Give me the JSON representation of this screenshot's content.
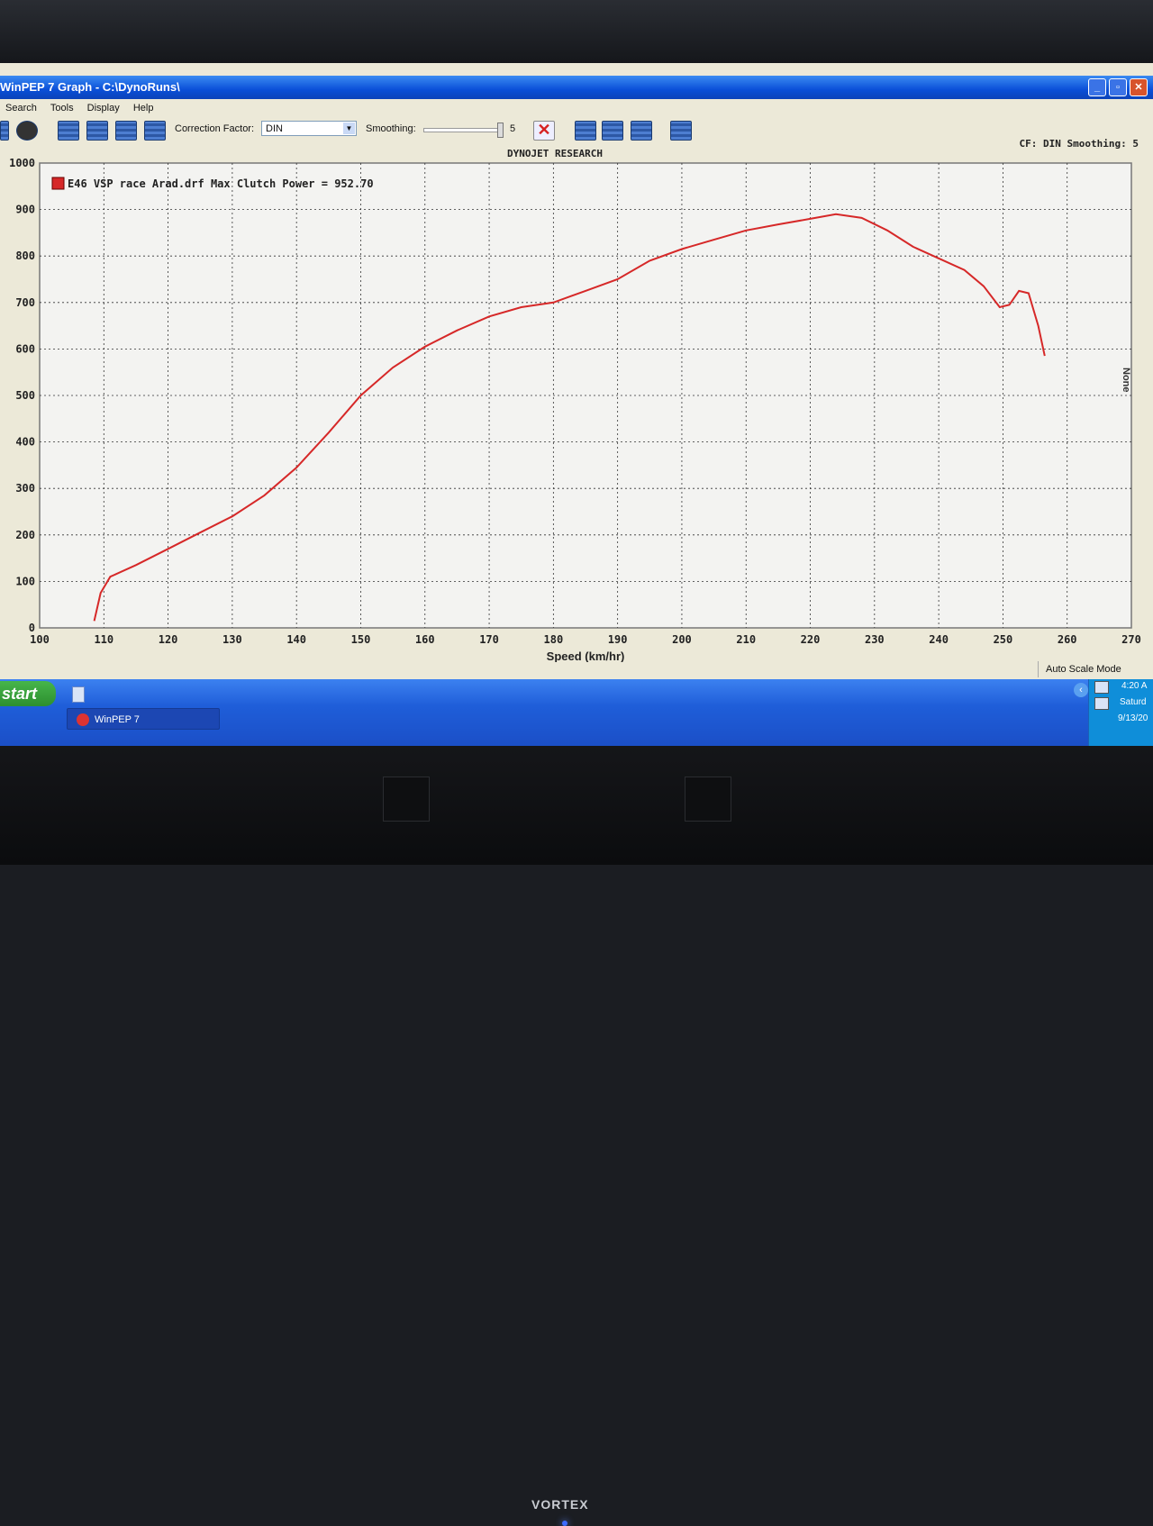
{
  "window": {
    "title": "WinPEP 7     Graph - C:\\DynoRuns\\",
    "controls": [
      "_",
      "▫",
      "✕"
    ]
  },
  "menu": [
    "Search",
    "Tools",
    "Display",
    "Help"
  ],
  "toolbar": {
    "correction_label": "Correction Factor:",
    "correction_value": "DIN",
    "smoothing_label": "Smoothing:",
    "smoothing_value": "5"
  },
  "header": {
    "brand": "DYNOJET RESEARCH",
    "cf_info": "CF: DIN  Smoothing: 5"
  },
  "side_label": "None",
  "status": {
    "mode": "Auto Scale Mode"
  },
  "taskbar": {
    "start_label": "start",
    "task_label": "WinPEP 7",
    "clock_time": "4:20 A",
    "clock_day": "Saturd",
    "clock_date": "9/13/20"
  },
  "monitor": {
    "brand": "VORTEX"
  },
  "colors": {
    "trace": "#d62828",
    "grid": "#333333",
    "plot_bg": "#f3f3f1"
  },
  "chart_data": {
    "type": "line",
    "title": "",
    "xlabel": "Speed (km/hr)",
    "ylabel": "",
    "xlim": [
      100,
      270
    ],
    "ylim": [
      0,
      1000
    ],
    "x_ticks": [
      "100",
      "110",
      "120",
      "130",
      "140",
      "150",
      "160",
      "170",
      "180",
      "190",
      "200",
      "210",
      "220",
      "230",
      "240",
      "250",
      "260",
      "270"
    ],
    "y_ticks": [
      "0",
      "100",
      "200",
      "300",
      "400",
      "500",
      "600",
      "700",
      "800",
      "900",
      "1000"
    ],
    "grid": true,
    "legend": "top-left",
    "series": [
      {
        "name": "E46 VSP race Arad.drf Max Clutch Power = 952.70",
        "color": "#d62828",
        "points": [
          [
            108.5,
            15
          ],
          [
            109.5,
            75
          ],
          [
            111,
            110
          ],
          [
            115,
            135
          ],
          [
            120,
            170
          ],
          [
            125,
            205
          ],
          [
            130,
            240
          ],
          [
            135,
            285
          ],
          [
            140,
            345
          ],
          [
            145,
            420
          ],
          [
            150,
            500
          ],
          [
            155,
            560
          ],
          [
            160,
            605
          ],
          [
            165,
            640
          ],
          [
            170,
            670
          ],
          [
            175,
            690
          ],
          [
            180,
            700
          ],
          [
            185,
            725
          ],
          [
            190,
            750
          ],
          [
            195,
            790
          ],
          [
            200,
            815
          ],
          [
            205,
            835
          ],
          [
            210,
            855
          ],
          [
            215,
            868
          ],
          [
            220,
            880
          ],
          [
            224,
            890
          ],
          [
            228,
            882
          ],
          [
            232,
            855
          ],
          [
            236,
            820
          ],
          [
            240,
            795
          ],
          [
            244,
            770
          ],
          [
            247,
            735
          ],
          [
            249.5,
            690
          ],
          [
            251,
            695
          ],
          [
            252.5,
            725
          ],
          [
            254,
            720
          ],
          [
            255.5,
            650
          ],
          [
            256.5,
            585
          ]
        ]
      }
    ]
  }
}
